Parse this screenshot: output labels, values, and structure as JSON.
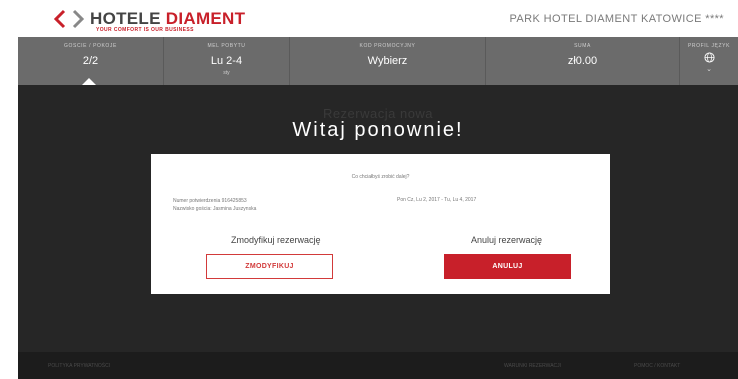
{
  "header": {
    "logo_prefix": "HOTELE ",
    "logo_brand": "DIAMENT",
    "logo_tagline": "YOUR COMFORT IS OUR BUSINESS",
    "hotel_name": "PARK HOTEL DIAMENT KATOWICE ****",
    "brand_color": "#c8202a"
  },
  "booking_bar": {
    "guests": {
      "caption": "GOŚCIE / POKOJE",
      "value": "2/2"
    },
    "dates": {
      "caption": "MEL POBYTU",
      "value": "Lu 2-4",
      "sub": "sty"
    },
    "promo": {
      "caption": "KOD PROMOCYJNY",
      "value": "Wybierz"
    },
    "total": {
      "caption": "SUMA",
      "value": "zł0.00"
    },
    "language": {
      "caption": "PROFIL JĘZYK",
      "icon": "globe-icon",
      "chevron": "chevron-down-icon"
    }
  },
  "main": {
    "ghost_heading": "Rezerwacja nowa",
    "welcome": "Witaj ponownie!"
  },
  "card": {
    "question": "Co chciałbyś zrobić dalej?",
    "confirmation_line": "Numer potwierdzenia 916425853",
    "guest_line": "Nazwisko gościa: Jasmina Juszynska",
    "dates_line": "Pon Cz, Lu 2, 2017 - Tu, Lu 4, 2017",
    "modify_label": "Zmodyfikuj rezerwację",
    "cancel_label": "Anuluj rezerwację",
    "modify_button": "ZMODYFIKUJ",
    "cancel_button": "ANULUJ"
  },
  "footer": {
    "left_link": "POLITYKA PRYWATNOŚCI",
    "mid_link": "WARUNKI REZERWACJI",
    "right_link": "POMOC / KONTAKT"
  }
}
